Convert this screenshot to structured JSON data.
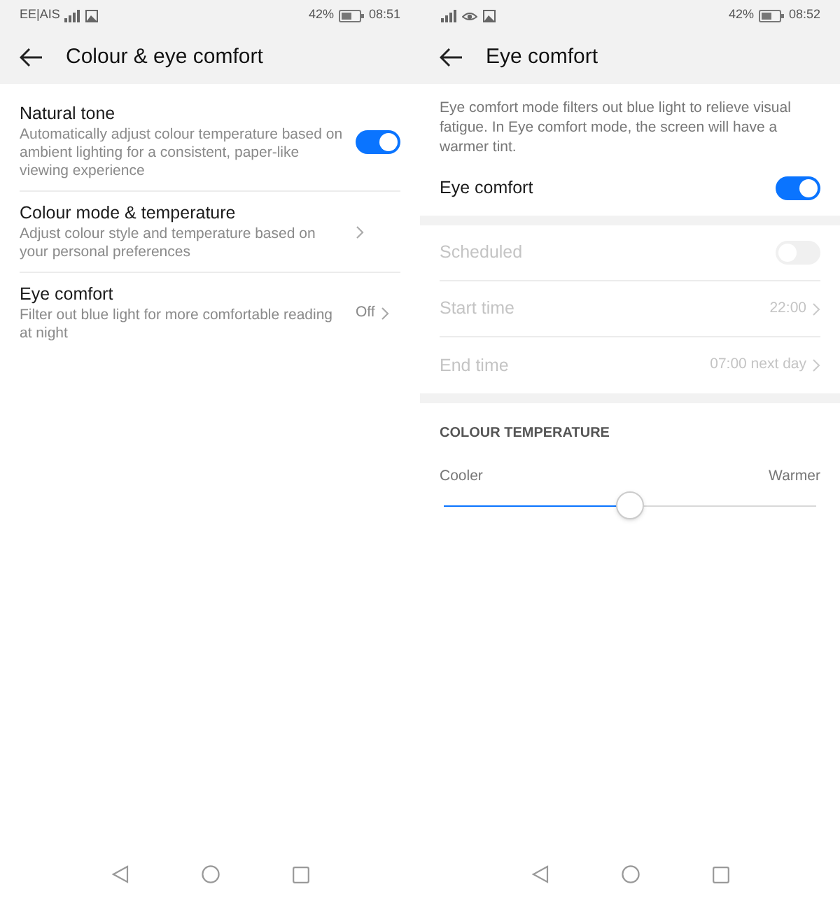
{
  "screens": [
    {
      "status_bar": {
        "carrier": "EE|AIS",
        "battery": "42%",
        "time": "08:51",
        "icons": [
          {
            "kind": "signal"
          },
          {
            "kind": "image"
          }
        ]
      },
      "title": "Colour & eye comfort",
      "groups": [
        {
          "rows": [
            {
              "kind": "toggle",
              "title": "Natural tone",
              "subtitle": "Automatically adjust colour temperature based on ambient lighting for a consistent, paper-like viewing experience",
              "on": true,
              "disabled": false
            },
            {
              "kind": "link",
              "title": "Colour mode & temperature",
              "subtitle": "Adjust colour style and temperature based on your personal preferences",
              "disabled": false
            },
            {
              "kind": "link",
              "title": "Eye comfort",
              "subtitle": "Filter out blue light for more comfortable reading at night",
              "value": "Off",
              "disabled": false
            }
          ]
        }
      ]
    },
    {
      "status_bar": {
        "battery": "42%",
        "time": "08:52",
        "icons": [
          {
            "kind": "signal"
          },
          {
            "kind": "eye"
          },
          {
            "kind": "image"
          }
        ]
      },
      "title": "Eye comfort",
      "description": "Eye comfort mode filters out blue light to relieve visual fatigue. In Eye comfort mode, the screen will have a warmer tint.",
      "groups": [
        {
          "rows": [
            {
              "kind": "toggle",
              "title": "Eye comfort",
              "on": true,
              "disabled": false
            }
          ]
        },
        {
          "rows": [
            {
              "kind": "toggle",
              "title": "Scheduled",
              "on": false,
              "disabled": true
            },
            {
              "kind": "link",
              "title": "Start time",
              "value": "22:00",
              "disabled": true
            },
            {
              "kind": "link",
              "title": "End time",
              "value": "07:00 next day",
              "disabled": true
            }
          ]
        }
      ],
      "colour_temperature": {
        "heading": "COLOUR TEMPERATURE",
        "min_label": "Cooler",
        "max_label": "Warmer",
        "level": 0.5
      }
    }
  ]
}
